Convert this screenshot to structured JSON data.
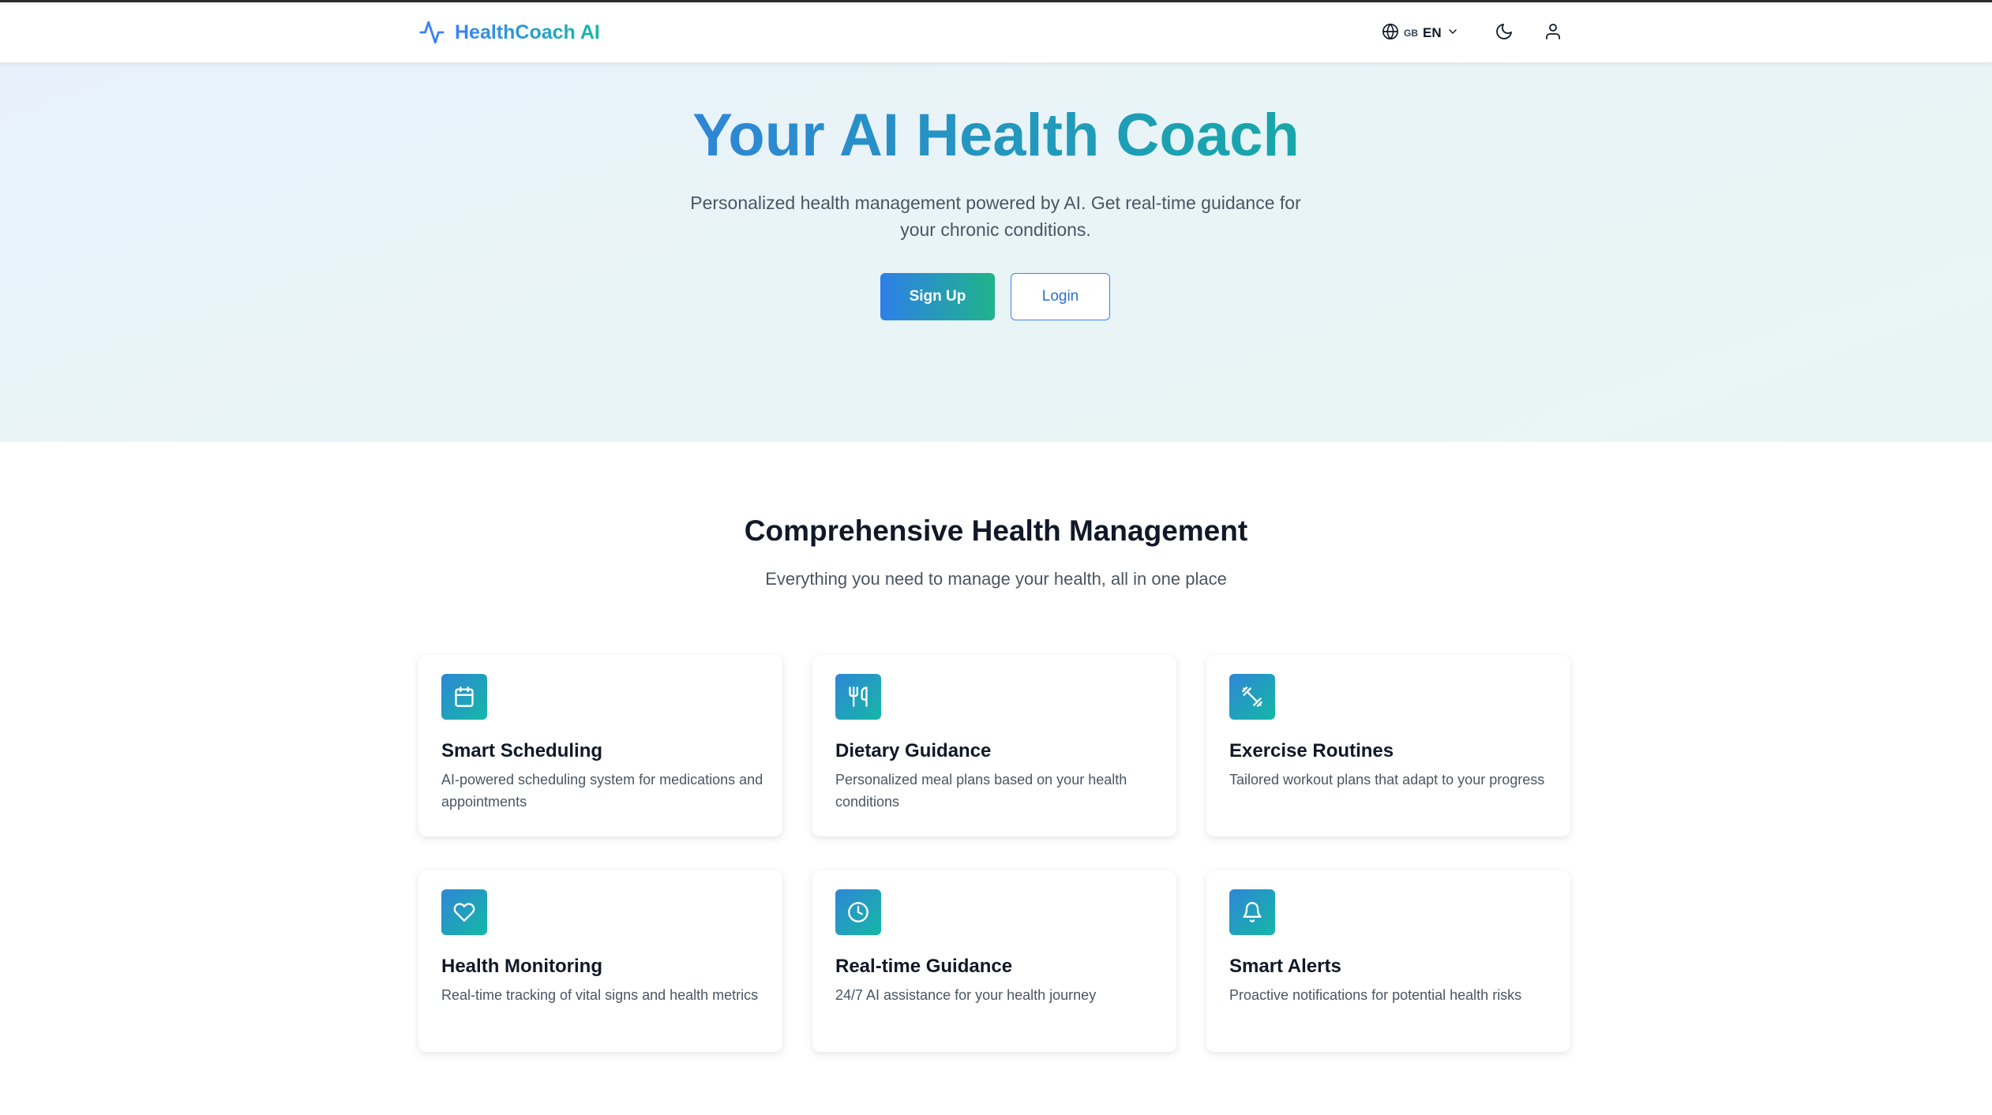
{
  "navbar": {
    "brand_name": "HealthCoach AI",
    "brand_icon": "activity-pulse-icon",
    "language_flag": "GB",
    "language_code": "EN",
    "theme_icon": "moon-icon",
    "user_icon": "user-icon"
  },
  "hero": {
    "title": "Your AI Health Coach",
    "subtitle": "Personalized health management powered by AI. Get real-time guidance for your chronic conditions.",
    "signup_label": "Sign Up",
    "login_label": "Login"
  },
  "features": {
    "title": "Comprehensive Health Management",
    "subtitle": "Everything you need to manage your health, all in one place",
    "cards": [
      {
        "icon": "calendar-icon",
        "title": "Smart Scheduling",
        "description": "AI-powered scheduling system for medications and appointments"
      },
      {
        "icon": "utensils-icon",
        "title": "Dietary Guidance",
        "description": "Personalized meal plans based on your health conditions"
      },
      {
        "icon": "dumbbell-icon",
        "title": "Exercise Routines",
        "description": "Tailored workout plans that adapt to your progress"
      },
      {
        "icon": "heart-icon",
        "title": "Health Monitoring",
        "description": "Real-time tracking of vital signs and health metrics"
      },
      {
        "icon": "clock-icon",
        "title": "Real-time Guidance",
        "description": "24/7 AI assistance for your health journey"
      },
      {
        "icon": "bell-icon",
        "title": "Smart Alerts",
        "description": "Proactive notifications for potential health risks"
      }
    ]
  },
  "colors": {
    "brand_gradient_start": "#3b82f6",
    "brand_gradient_end": "#14b8a6",
    "hero_background": "#e8f1fb",
    "text_primary": "#111827",
    "text_secondary": "#4b5563"
  }
}
